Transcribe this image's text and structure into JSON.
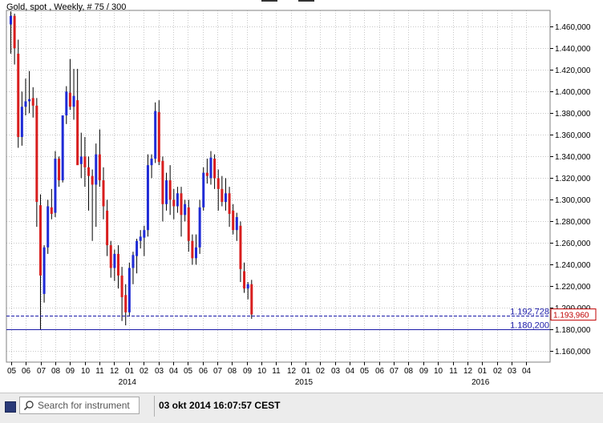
{
  "title": "Gold, spot , Weekly, # 75 / 300",
  "status_bar": {
    "search_placeholder": "Search for instrument",
    "timestamp": "03 okt 2014 16:07:57 CEST"
  },
  "colors": {
    "up": "#1f2bd6",
    "down": "#d81e1e",
    "wick": "#000000",
    "level_line": "#1a1aa8",
    "current_price": "#c00000",
    "grid": "#c8c8c8",
    "background": "#ffffff"
  },
  "chart_data": {
    "type": "candlestick",
    "timeframe": "Weekly",
    "y_axis": {
      "range": [
        1150,
        1475
      ],
      "ticks": [
        "1.160,000",
        "1.180,000",
        "1.200,000",
        "1.220,000",
        "1.240,000",
        "1.260,000",
        "1.280,000",
        "1.300,000",
        "1.320,000",
        "1.340,000",
        "1.360,000",
        "1.380,000",
        "1.400,000",
        "1.420,000",
        "1.440,000",
        "1.460,000"
      ],
      "tick_values": [
        1160,
        1180,
        1200,
        1220,
        1240,
        1260,
        1280,
        1300,
        1320,
        1340,
        1360,
        1380,
        1400,
        1420,
        1440,
        1460
      ],
      "position": "right",
      "grid": true
    },
    "x_axis": {
      "month_labels": [
        "05",
        "06",
        "07",
        "08",
        "09",
        "10",
        "11",
        "12",
        "01",
        "02",
        "03",
        "04",
        "05",
        "06",
        "07",
        "08",
        "09",
        "10",
        "11",
        "12",
        "01",
        "02",
        "03",
        "04",
        "05",
        "06",
        "07",
        "08",
        "09",
        "10",
        "11",
        "12",
        "01",
        "02",
        "03",
        "04"
      ],
      "year_labels": [
        {
          "text": "2014",
          "month_index": 8
        },
        {
          "text": "2015",
          "month_index": 20
        },
        {
          "text": "2016",
          "month_index": 32
        }
      ],
      "grid": true
    },
    "levels": [
      {
        "value": 1192.728,
        "label": "1.192,728",
        "style": "dashed"
      },
      {
        "value": 1180.2,
        "label": "1.180,200",
        "style": "solid"
      }
    ],
    "current_price": {
      "value": 1193.96,
      "label": "1.193,960"
    },
    "candles": [
      {
        "o": 1462,
        "h": 1474,
        "l": 1435,
        "c": 1470
      },
      {
        "o": 1470,
        "h": 1472,
        "l": 1425,
        "c": 1440
      },
      {
        "o": 1435,
        "h": 1448,
        "l": 1348,
        "c": 1358
      },
      {
        "o": 1358,
        "h": 1400,
        "l": 1350,
        "c": 1386
      },
      {
        "o": 1386,
        "h": 1412,
        "l": 1378,
        "c": 1391
      },
      {
        "o": 1391,
        "h": 1419,
        "l": 1380,
        "c": 1393
      },
      {
        "o": 1394,
        "h": 1404,
        "l": 1376,
        "c": 1387
      },
      {
        "o": 1387,
        "h": 1394,
        "l": 1275,
        "c": 1298
      },
      {
        "o": 1295,
        "h": 1305,
        "l": 1180,
        "c": 1230
      },
      {
        "o": 1213,
        "h": 1258,
        "l": 1205,
        "c": 1256
      },
      {
        "o": 1256,
        "h": 1300,
        "l": 1250,
        "c": 1294
      },
      {
        "o": 1293,
        "h": 1310,
        "l": 1282,
        "c": 1287
      },
      {
        "o": 1288,
        "h": 1345,
        "l": 1284,
        "c": 1338
      },
      {
        "o": 1338,
        "h": 1340,
        "l": 1312,
        "c": 1318
      },
      {
        "o": 1318,
        "h": 1370,
        "l": 1316,
        "c": 1378
      },
      {
        "o": 1378,
        "h": 1405,
        "l": 1370,
        "c": 1400
      },
      {
        "o": 1399,
        "h": 1430,
        "l": 1383,
        "c": 1386
      },
      {
        "o": 1386,
        "h": 1421,
        "l": 1374,
        "c": 1396
      },
      {
        "o": 1392,
        "h": 1421,
        "l": 1350,
        "c": 1332
      },
      {
        "o": 1333,
        "h": 1362,
        "l": 1320,
        "c": 1340
      },
      {
        "o": 1340,
        "h": 1358,
        "l": 1312,
        "c": 1330
      },
      {
        "o": 1330,
        "h": 1340,
        "l": 1290,
        "c": 1322
      },
      {
        "o": 1322,
        "h": 1328,
        "l": 1262,
        "c": 1314
      },
      {
        "o": 1314,
        "h": 1352,
        "l": 1275,
        "c": 1342
      },
      {
        "o": 1342,
        "h": 1365,
        "l": 1312,
        "c": 1318
      },
      {
        "o": 1318,
        "h": 1330,
        "l": 1282,
        "c": 1294
      },
      {
        "o": 1290,
        "h": 1300,
        "l": 1248,
        "c": 1258
      },
      {
        "o": 1258,
        "h": 1262,
        "l": 1228,
        "c": 1237
      },
      {
        "o": 1237,
        "h": 1254,
        "l": 1225,
        "c": 1250
      },
      {
        "o": 1250,
        "h": 1258,
        "l": 1218,
        "c": 1230
      },
      {
        "o": 1230,
        "h": 1238,
        "l": 1188,
        "c": 1210
      },
      {
        "o": 1212,
        "h": 1222,
        "l": 1184,
        "c": 1196
      },
      {
        "o": 1196,
        "h": 1242,
        "l": 1192,
        "c": 1237
      },
      {
        "o": 1237,
        "h": 1252,
        "l": 1222,
        "c": 1249
      },
      {
        "o": 1248,
        "h": 1264,
        "l": 1232,
        "c": 1262
      },
      {
        "o": 1262,
        "h": 1272,
        "l": 1255,
        "c": 1266
      },
      {
        "o": 1265,
        "h": 1276,
        "l": 1248,
        "c": 1272
      },
      {
        "o": 1272,
        "h": 1342,
        "l": 1266,
        "c": 1332
      },
      {
        "o": 1332,
        "h": 1342,
        "l": 1320,
        "c": 1338
      },
      {
        "o": 1338,
        "h": 1390,
        "l": 1334,
        "c": 1382
      },
      {
        "o": 1381,
        "h": 1392,
        "l": 1332,
        "c": 1335
      },
      {
        "o": 1336,
        "h": 1340,
        "l": 1280,
        "c": 1296
      },
      {
        "o": 1296,
        "h": 1325,
        "l": 1290,
        "c": 1318
      },
      {
        "o": 1318,
        "h": 1332,
        "l": 1286,
        "c": 1300
      },
      {
        "o": 1300,
        "h": 1310,
        "l": 1282,
        "c": 1294
      },
      {
        "o": 1294,
        "h": 1312,
        "l": 1288,
        "c": 1306
      },
      {
        "o": 1306,
        "h": 1312,
        "l": 1266,
        "c": 1286
      },
      {
        "o": 1286,
        "h": 1300,
        "l": 1280,
        "c": 1296
      },
      {
        "o": 1293,
        "h": 1300,
        "l": 1252,
        "c": 1262
      },
      {
        "o": 1262,
        "h": 1268,
        "l": 1240,
        "c": 1246
      },
      {
        "o": 1246,
        "h": 1268,
        "l": 1240,
        "c": 1256
      },
      {
        "o": 1256,
        "h": 1300,
        "l": 1250,
        "c": 1293
      },
      {
        "o": 1293,
        "h": 1330,
        "l": 1290,
        "c": 1325
      },
      {
        "o": 1325,
        "h": 1338,
        "l": 1315,
        "c": 1322
      },
      {
        "o": 1320,
        "h": 1345,
        "l": 1314,
        "c": 1339
      },
      {
        "o": 1338,
        "h": 1342,
        "l": 1310,
        "c": 1320
      },
      {
        "o": 1320,
        "h": 1328,
        "l": 1290,
        "c": 1310
      },
      {
        "o": 1310,
        "h": 1322,
        "l": 1294,
        "c": 1298
      },
      {
        "o": 1298,
        "h": 1320,
        "l": 1290,
        "c": 1306
      },
      {
        "o": 1306,
        "h": 1312,
        "l": 1275,
        "c": 1287
      },
      {
        "o": 1290,
        "h": 1296,
        "l": 1268,
        "c": 1272
      },
      {
        "o": 1272,
        "h": 1288,
        "l": 1262,
        "c": 1284
      },
      {
        "o": 1276,
        "h": 1280,
        "l": 1224,
        "c": 1236
      },
      {
        "o": 1234,
        "h": 1242,
        "l": 1214,
        "c": 1218
      },
      {
        "o": 1218,
        "h": 1224,
        "l": 1208,
        "c": 1222
      },
      {
        "o": 1222,
        "h": 1226,
        "l": 1190,
        "c": 1194
      }
    ]
  }
}
